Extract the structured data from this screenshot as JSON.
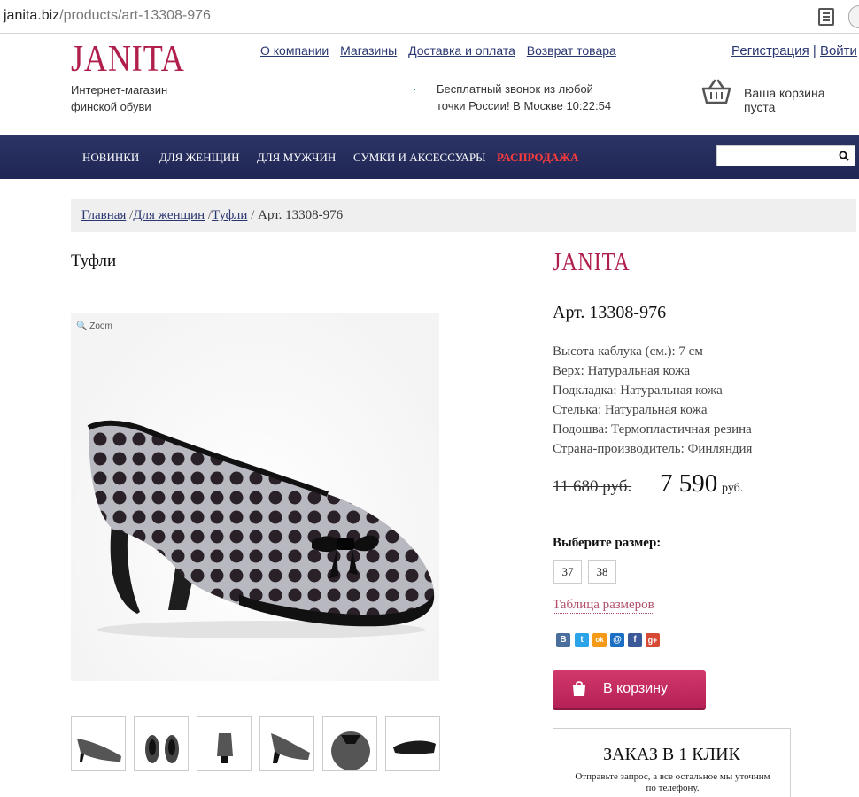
{
  "browser": {
    "url_host": "janita.biz",
    "url_path": "/products/art-13308-976"
  },
  "header": {
    "logo": "JANITA",
    "tagline_line1": "Интернет-магазин",
    "tagline_line2": "финской обуви",
    "links": [
      "О компании",
      "Магазины",
      "Доставка и оплата",
      "Возврат товара"
    ],
    "register": "Регистрация",
    "auth_separator": "|",
    "login": "Войти",
    "phone_line1": "Бесплатный звонок из любой",
    "phone_line2": "точки России! В Москве 10:22:54",
    "cart_label": "Ваша корзина пуста"
  },
  "nav": {
    "items": [
      "НОВИНКИ",
      "ДЛЯ ЖЕНЩИН",
      "ДЛЯ МУЖЧИН",
      "СУМКИ И АКСЕССУАРЫ",
      "РАСПРОДАЖА"
    ],
    "search_placeholder": ""
  },
  "breadcrumb": {
    "home": "Главная",
    "women": "Для женщин",
    "shoes": "Туфли",
    "current": "Арт. 13308-976",
    "sep": "/"
  },
  "product": {
    "title": "Туфли",
    "zoom_label": "Zoom",
    "brand": "JANITA",
    "article": "Арт. 13308-976",
    "specs": [
      "Высота каблука (см.): 7 см",
      "Верх: Натуральная кожа",
      "Подкладка: Натуральная кожа",
      "Стелька: Натуральная кожа",
      "Подошва: Термопластичная резина",
      "Страна-производитель: Финляндия"
    ],
    "price_old": "11 680 руб.",
    "price_new": "7 590",
    "price_currency": "руб.",
    "size_label": "Выберите размер:",
    "sizes": [
      "37",
      "38"
    ],
    "size_table": "Таблица размеров",
    "social": [
      "В",
      "t",
      "ok",
      "@",
      "f",
      "g+"
    ],
    "add_to_cart": "В корзину",
    "oneclick_title": "ЗАКАЗ В 1 КЛИК",
    "oneclick_desc": "Отправьте запрос, а все остальное мы уточним по телефону."
  },
  "colors": {
    "brand": "#b01f4c",
    "nav_bg": "#252c5c",
    "sale": "#ff3b3b",
    "link": "#2a3670",
    "cart_btn": "#c42a60"
  }
}
